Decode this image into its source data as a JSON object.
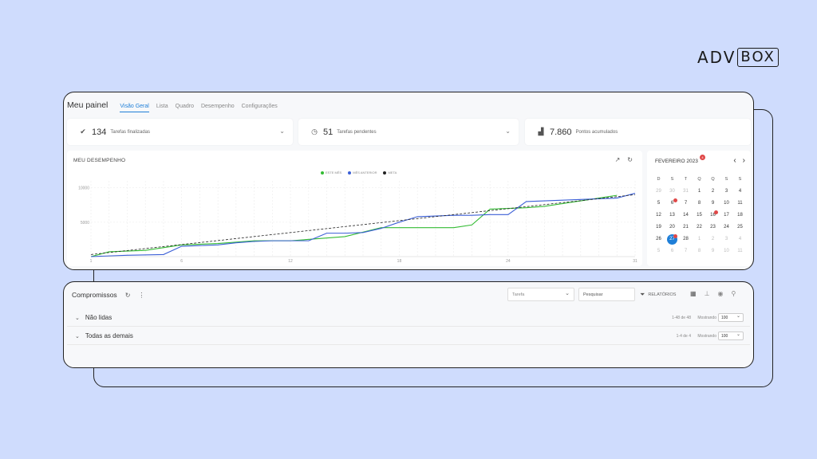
{
  "brand": {
    "part1": "ADV",
    "part2": "BOX"
  },
  "header": {
    "title": "Meu painel",
    "tabs": [
      "Visão Geral",
      "Lista",
      "Quadro",
      "Desempenho",
      "Configurações"
    ],
    "active_tab": "Visão Geral"
  },
  "stats": [
    {
      "value": "134",
      "label": "Tarefas finalizadas",
      "icon": "double-check-icon"
    },
    {
      "value": "51",
      "label": "Tarefas pendentes",
      "icon": "clock-icon"
    },
    {
      "value": "7.860",
      "label": "Pontos acumulados",
      "icon": "chart-icon"
    }
  ],
  "performance": {
    "title": "MEU DESEMPENHO",
    "legend": [
      "ESTE MÊS",
      "MÊS ANTERIOR",
      "META"
    ]
  },
  "chart_data": {
    "type": "line",
    "title": "MEU DESEMPENHO",
    "xlabel": "",
    "ylabel": "",
    "xlim": [
      1,
      31
    ],
    "ylim": [
      0,
      11000
    ],
    "x_ticks": [
      "1",
      "6",
      "12",
      "18",
      "24",
      "31"
    ],
    "y_ticks": [
      "10000",
      "5000"
    ],
    "legend_position": "top-center",
    "grid": true,
    "series": [
      {
        "name": "ESTE MÊS",
        "color": "#33bb33",
        "x": [
          1,
          2,
          4,
          6,
          8,
          10,
          12,
          15,
          17,
          19,
          21,
          22,
          23,
          24,
          25,
          26,
          28,
          30
        ],
        "y": [
          0,
          700,
          900,
          1700,
          1900,
          2300,
          2300,
          2900,
          4200,
          4200,
          4200,
          4600,
          6900,
          7000,
          7100,
          7300,
          8100,
          8900
        ]
      },
      {
        "name": "MÊS ANTERIOR",
        "color": "#3b5fd6",
        "x": [
          1,
          2,
          3,
          5,
          6,
          7,
          8,
          9,
          10,
          11,
          12,
          13,
          14,
          15,
          16,
          17,
          18,
          19,
          20,
          21,
          22,
          23,
          24,
          25,
          26,
          27,
          28,
          29,
          30,
          31
        ],
        "y": [
          0,
          100,
          200,
          300,
          1500,
          1600,
          1700,
          2000,
          2200,
          2300,
          2300,
          2300,
          3400,
          3400,
          3500,
          4100,
          5000,
          5800,
          5900,
          6000,
          6000,
          6100,
          6100,
          8000,
          8100,
          8200,
          8300,
          8400,
          8500,
          9200
        ]
      },
      {
        "name": "META",
        "color": "#222222",
        "dashed": true,
        "x": [
          1,
          31
        ],
        "y": [
          300,
          9000
        ]
      }
    ]
  },
  "calendar": {
    "month": "FEVEREIRO 2023",
    "badge": "4",
    "weekdays": [
      "D",
      "S",
      "T",
      "Q",
      "Q",
      "S",
      "S"
    ],
    "days": [
      [
        "29",
        "30",
        "31",
        "1",
        "2",
        "3",
        "4"
      ],
      [
        "5",
        "6",
        "7",
        "8",
        "9",
        "10",
        "11"
      ],
      [
        "12",
        "13",
        "14",
        "15",
        "16",
        "17",
        "18"
      ],
      [
        "19",
        "20",
        "21",
        "22",
        "23",
        "24",
        "25"
      ],
      [
        "26",
        "27",
        "28",
        "1",
        "2",
        "3",
        "4"
      ],
      [
        "5",
        "6",
        "7",
        "8",
        "9",
        "10",
        "11"
      ]
    ],
    "today": "27"
  },
  "compromissos": {
    "title": "Compromissos",
    "filter_placeholder": "Tarefa",
    "search_placeholder": "Pesquisar",
    "reports_label": "RELATÓRIOS",
    "rows": [
      {
        "name": "Não lidas",
        "count": "1-48 de 48",
        "show_label": "Mostrando",
        "show_value": "100"
      },
      {
        "name": "Todas as demais",
        "count": "1-4 de 4",
        "show_label": "Mostrando",
        "show_value": "100"
      }
    ]
  }
}
